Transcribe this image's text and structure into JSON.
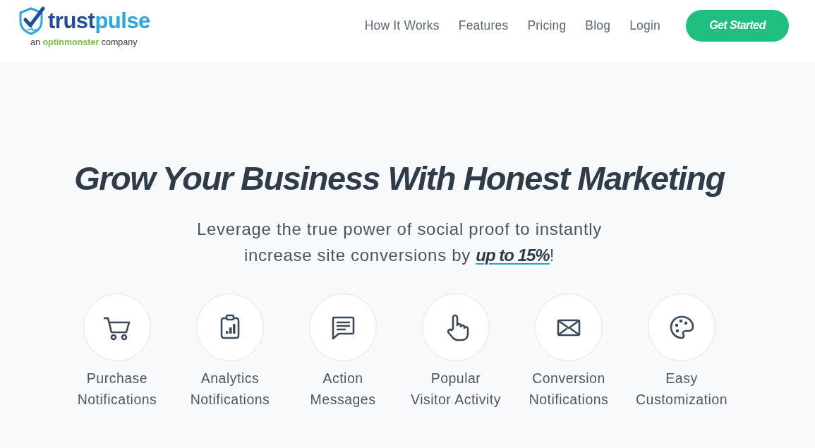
{
  "header": {
    "logo": {
      "wordmark": {
        "first": "trust",
        "second": "pulse"
      },
      "tagline": {
        "before": "an",
        "brand": "optinmonster",
        "after": "company"
      }
    },
    "nav": [
      "How It Works",
      "Features",
      "Pricing",
      "Blog",
      "Login"
    ],
    "cta_button": "Get Started"
  },
  "hero": {
    "title": "Grow Your Business With Honest Marketing",
    "subtitle_lines": [
      "Leverage the true power of social proof to instantly",
      "increase site conversions by **up to 15%**!"
    ]
  },
  "features": [
    {
      "kind": "cart",
      "label_lines": [
        "Purchase",
        "Notifications"
      ]
    },
    {
      "kind": "clipboard-chart",
      "label_lines": [
        "Analytics",
        "Notifications"
      ]
    },
    {
      "kind": "chat",
      "label_lines": [
        "Action",
        "Messages"
      ]
    },
    {
      "kind": "pointer",
      "label_lines": [
        "Popular",
        "Visitor Activity"
      ]
    },
    {
      "kind": "envelope",
      "label_lines": [
        "Conversion",
        "Notifications"
      ]
    },
    {
      "kind": "palette",
      "label_lines": [
        "Easy",
        "Customization"
      ]
    }
  ]
}
